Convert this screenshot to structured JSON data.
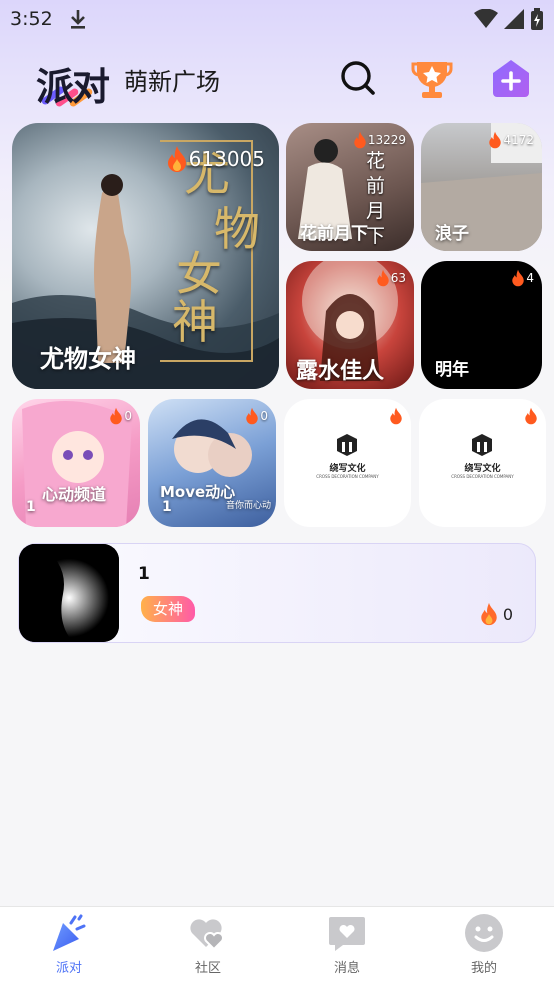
{
  "status": {
    "time": "3:52"
  },
  "header": {
    "logo_text": "派对",
    "title": "萌新广场"
  },
  "featured": {
    "big": {
      "name": "尤物女神",
      "heat": "613005",
      "poster_line1": "尤",
      "poster_line2": "物",
      "poster_line3": "女",
      "poster_line4": "神"
    },
    "top_right": [
      {
        "name": "花前月下",
        "heat": "13229",
        "poster_text": "花前月下"
      },
      {
        "name": "浪子",
        "heat": "4172"
      }
    ],
    "mid_right": [
      {
        "name": "露水佳人",
        "heat": "63"
      },
      {
        "name": "明年",
        "heat": "4"
      }
    ]
  },
  "rooms_small": [
    {
      "name": "心动频道",
      "count": "1",
      "heat": "0"
    },
    {
      "name": "Move动心",
      "count": "1",
      "heat": "0",
      "subtitle": "音你而心动"
    },
    {
      "name": "",
      "brand": "绕写文化",
      "brand_sub": "CROSS DECORATION COMPANY"
    },
    {
      "name": "",
      "brand": "绕写文化",
      "brand_sub": "CROSS DECORATION COMPANY"
    }
  ],
  "room_list": [
    {
      "name": "1",
      "tag": "女神",
      "heat": "0"
    }
  ],
  "tabs": [
    {
      "label": "派对",
      "active": true
    },
    {
      "label": "社区",
      "active": false
    },
    {
      "label": "消息",
      "active": false
    },
    {
      "label": "我的",
      "active": false
    }
  ],
  "colors": {
    "accent": "#4e73f6",
    "tag_gradient_start": "#ffb14a",
    "tag_gradient_end": "#ff5aa8",
    "flame": "#ff6a2b"
  }
}
